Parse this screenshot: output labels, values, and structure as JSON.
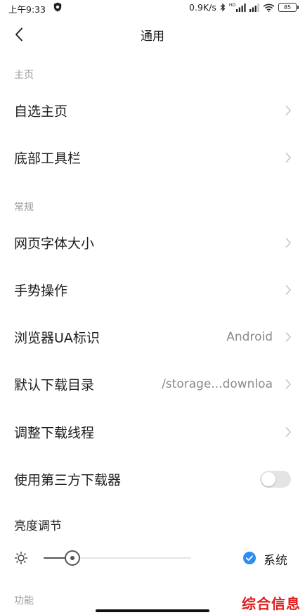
{
  "status_bar": {
    "time": "上午9:33",
    "net_speed": "0.9K/s",
    "hd_label": "HD",
    "battery": "85"
  },
  "header": {
    "title": "通用"
  },
  "sections": {
    "home": "主页",
    "general": "常规",
    "function": "功能"
  },
  "items": {
    "custom_home": {
      "label": "自选主页"
    },
    "bottom_toolbar": {
      "label": "底部工具栏"
    },
    "font_size": {
      "label": "网页字体大小"
    },
    "gestures": {
      "label": "手势操作"
    },
    "ua": {
      "label": "浏览器UA标识",
      "value": "Android"
    },
    "download_dir": {
      "label": "默认下载目录",
      "value": "/storage...downloa"
    },
    "download_threads": {
      "label": "调整下载线程"
    },
    "third_party_downloader": {
      "label": "使用第三方下载器",
      "enabled": false
    }
  },
  "brightness": {
    "title": "亮度调节",
    "level_fraction": 0.19,
    "system_label": "系统",
    "system_checked": true
  },
  "watermark": "综合信息",
  "colors": {
    "accent": "#2f8cf0",
    "watermark": "#e11d1d",
    "section_text": "#9a9a9a",
    "value_text": "#8a8a8a"
  },
  "icons": {
    "back": "chevron-left-icon",
    "row_arrow": "chevron-right-icon",
    "brightness": "sun-icon",
    "check": "check-circle-icon"
  }
}
